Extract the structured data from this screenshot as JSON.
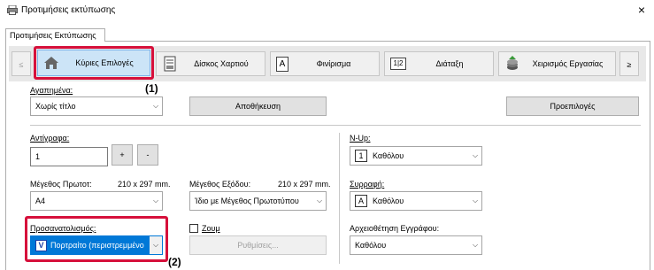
{
  "window": {
    "title": "Προτιμήσεις εκτύπωσης",
    "close_glyph": "×"
  },
  "tab": {
    "label": "Προτιμήσεις Εκτύπωσης"
  },
  "nav": {
    "prev_glyph": "≤",
    "next_glyph": "≥",
    "items": [
      {
        "label": "Κύριες Επιλογές",
        "icon": "home-icon"
      },
      {
        "label": "Δίσκος Χαρτιού",
        "icon": "paper-tray-icon"
      },
      {
        "label": "Φινίρισμα",
        "icon": "finishing-icon"
      },
      {
        "label": "Διάταξη",
        "icon": "layout-icon"
      },
      {
        "label": "Χειρισμός Εργασίας",
        "icon": "job-handling-icon"
      }
    ]
  },
  "favorites": {
    "label": "Αγαπημένα:",
    "value": "Χωρίς τίτλο",
    "save_label": "Αποθήκευση",
    "defaults_label": "Προεπιλογές"
  },
  "copies": {
    "label": "Αντίγραφα:",
    "value": "1",
    "plus": "+",
    "minus": "-"
  },
  "original_size": {
    "label": "Μέγεθος Πρωτοτ:",
    "dims": "210 x 297 mm.",
    "value": "A4"
  },
  "output_size": {
    "label": "Μέγεθος Εξόδου:",
    "dims": "210 x 297 mm.",
    "value": "Ίδιο με Μέγεθος Πρωτοτύπου"
  },
  "orientation": {
    "label": "Προσανατολισμός:",
    "value": "Πορτραίτο (περιστρεμμένο",
    "icon_glyph": "V"
  },
  "zoom": {
    "label": "Ζουμ",
    "settings_label": "Ρυθμίσεις..."
  },
  "nup": {
    "label": "N-Up:",
    "value": "Καθόλου",
    "icon_glyph": "1"
  },
  "collate": {
    "label": "Συρραφή:",
    "value": "Καθόλου",
    "icon_glyph": "A"
  },
  "document_filing": {
    "label": "Αρχειοθέτηση Εγγράφου:",
    "value": "Καθόλου"
  },
  "callouts": {
    "one": "(1)",
    "two": "(2)"
  },
  "colors": {
    "highlight": "#d6103b",
    "selected_tab": "#cce4f7"
  }
}
